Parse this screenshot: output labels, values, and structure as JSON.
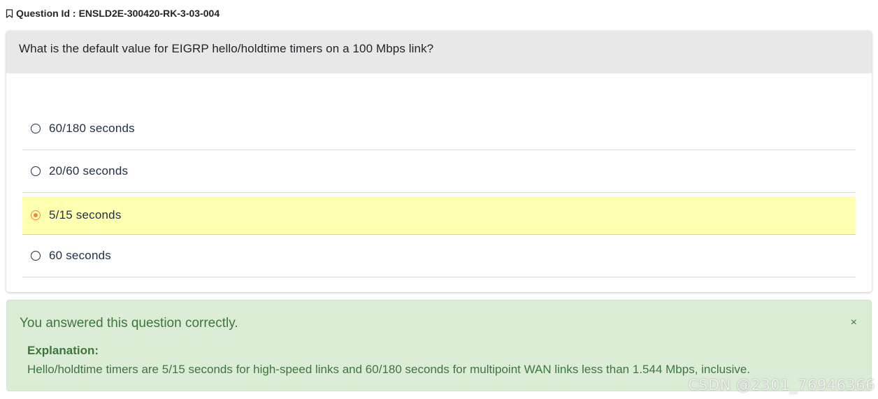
{
  "question": {
    "id_label": "Question Id :",
    "id_value": "ENSLD2E-300420-RK-3-03-004",
    "text": "What is the default value for EIGRP hello/holdtime timers on a 100 Mbps link?",
    "bookmark_icon": "bookmark-icon"
  },
  "options": [
    {
      "label": "60/180 seconds",
      "selected": false
    },
    {
      "label": "20/60 seconds",
      "selected": false
    },
    {
      "label": "5/15 seconds",
      "selected": true
    },
    {
      "label": "60 seconds",
      "selected": false
    }
  ],
  "feedback": {
    "message": "You answered this question correctly.",
    "close_glyph": "×",
    "explanation_heading": "Explanation:",
    "explanation_text": "Hello/holdtime timers are 5/15 seconds for high-speed links and 60/180 seconds for multipoint WAN links less than 1.544 Mbps, inclusive."
  },
  "watermark": "CSDN @2301_76946366",
  "colors": {
    "header_bg": "#e8e8e8",
    "selected_bg": "#ffffb0",
    "radio_selected": "#f08a3a",
    "success_bg": "#dcedd7",
    "success_text": "#3c763d"
  }
}
